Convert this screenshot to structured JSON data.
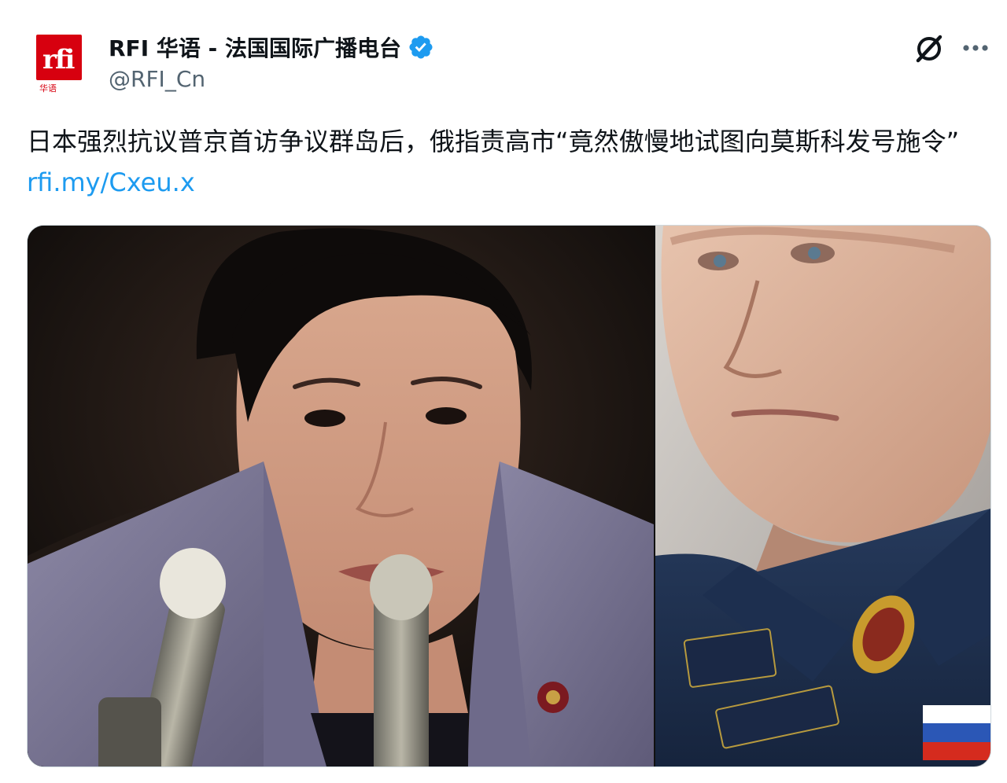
{
  "account": {
    "name": "RFI 华语 - 法国国际广播电台",
    "handle": "@RFI_Cn",
    "verified": true,
    "avatar_logo": "rfi",
    "avatar_sub": "华语"
  },
  "icons": {
    "verified": "verified-badge-icon",
    "grok": "grok-icon",
    "more": "more-options-icon"
  },
  "colors": {
    "link": "#1d9bf0",
    "verified": "#1d9bf0",
    "brand_red": "#d7000f"
  },
  "tweet": {
    "text": "日本强烈抗议普京首访争议群岛后，俄指责高市“竟然傲慢地试图向莫斯科发号施令”",
    "link": "rfi.my/Cxeu.x"
  },
  "media": {
    "count": 2
  }
}
